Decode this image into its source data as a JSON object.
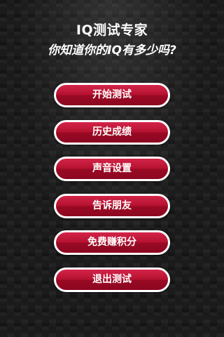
{
  "header": {
    "title": "IQ测试专家",
    "subtitle": "你知道你的IQ有多少吗?"
  },
  "menu": {
    "items": [
      {
        "label": "开始测试"
      },
      {
        "label": "历史成绩"
      },
      {
        "label": "声音设置"
      },
      {
        "label": "告诉朋友"
      },
      {
        "label": "免费赚积分"
      },
      {
        "label": "退出测试"
      }
    ]
  },
  "colors": {
    "button_red": "#b5122f",
    "button_border": "#ffffff",
    "text": "#ffffff",
    "background": "#1b1b1b"
  }
}
